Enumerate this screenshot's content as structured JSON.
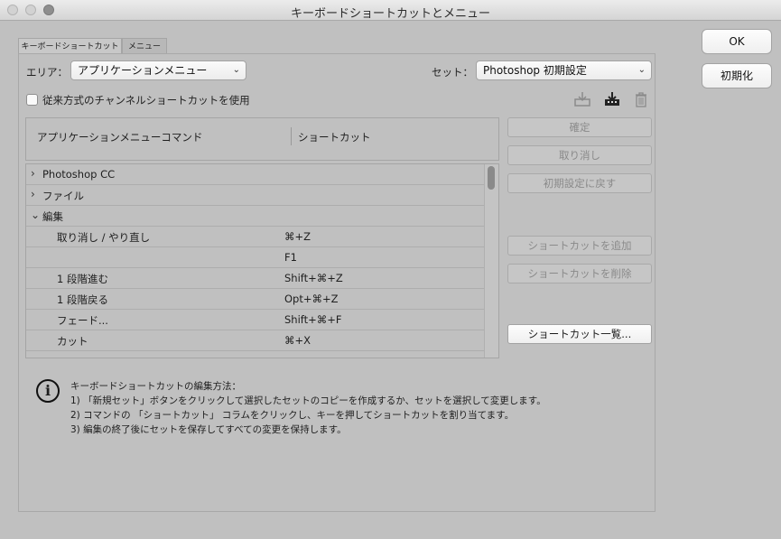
{
  "window": {
    "title": "キーボードショートカットとメニュー"
  },
  "tabs": [
    {
      "label": "キーボードショートカット"
    },
    {
      "label": "メニュー"
    }
  ],
  "area": {
    "label": "エリア：",
    "value": "アプリケーションメニュー"
  },
  "set": {
    "label": "セット：",
    "value": "Photoshop 初期設定"
  },
  "legacy_channel": {
    "label": "従来方式のチャンネルショートカットを使用",
    "checked": false
  },
  "table": {
    "col_command": "アプリケーションメニューコマンド",
    "col_shortcut": "ショートカット",
    "rows": [
      {
        "command": "Photoshop CC",
        "shortcut": "",
        "disclosure": "›",
        "level": 0
      },
      {
        "command": "ファイル",
        "shortcut": "",
        "disclosure": "›",
        "level": 0
      },
      {
        "command": "編集",
        "shortcut": "",
        "disclosure": "⌄",
        "level": 0
      },
      {
        "command": "取り消し / やり直し",
        "shortcut": "⌘+Z",
        "disclosure": "",
        "level": 1
      },
      {
        "command": "",
        "shortcut": "F1",
        "disclosure": "",
        "level": 1
      },
      {
        "command": "1 段階進む",
        "shortcut": "Shift+⌘+Z",
        "disclosure": "",
        "level": 1
      },
      {
        "command": "1 段階戻る",
        "shortcut": "Opt+⌘+Z",
        "disclosure": "",
        "level": 1
      },
      {
        "command": "フェード...",
        "shortcut": "Shift+⌘+F",
        "disclosure": "",
        "level": 1
      },
      {
        "command": "カット",
        "shortcut": "⌘+X",
        "disclosure": "",
        "level": 1
      }
    ]
  },
  "side_buttons": {
    "confirm": "確定",
    "undo": "取り消し",
    "reset": "初期設定に戻す",
    "add": "ショートカットを追加",
    "delete": "ショートカットを削除",
    "summary": "ショートカット一覧..."
  },
  "help": {
    "heading": "キーボードショートカットの編集方法：",
    "step1": "1) 「新規セット」ボタンをクリックして選択したセットのコピーを作成するか、セットを選択して変更します。",
    "step2": "2) コマンドの 「ショートカット」 コラムをクリックし、キーを押してショートカットを割り当てます。",
    "step3": "3) 編集の終了後にセットを保存してすべての変更を保持します。"
  },
  "buttons": {
    "ok": "OK",
    "init": "初期化"
  },
  "icons": {
    "save_set": "save-set-icon",
    "save_as": "save-as-icon",
    "trash": "trash-icon",
    "info": "info-icon"
  }
}
